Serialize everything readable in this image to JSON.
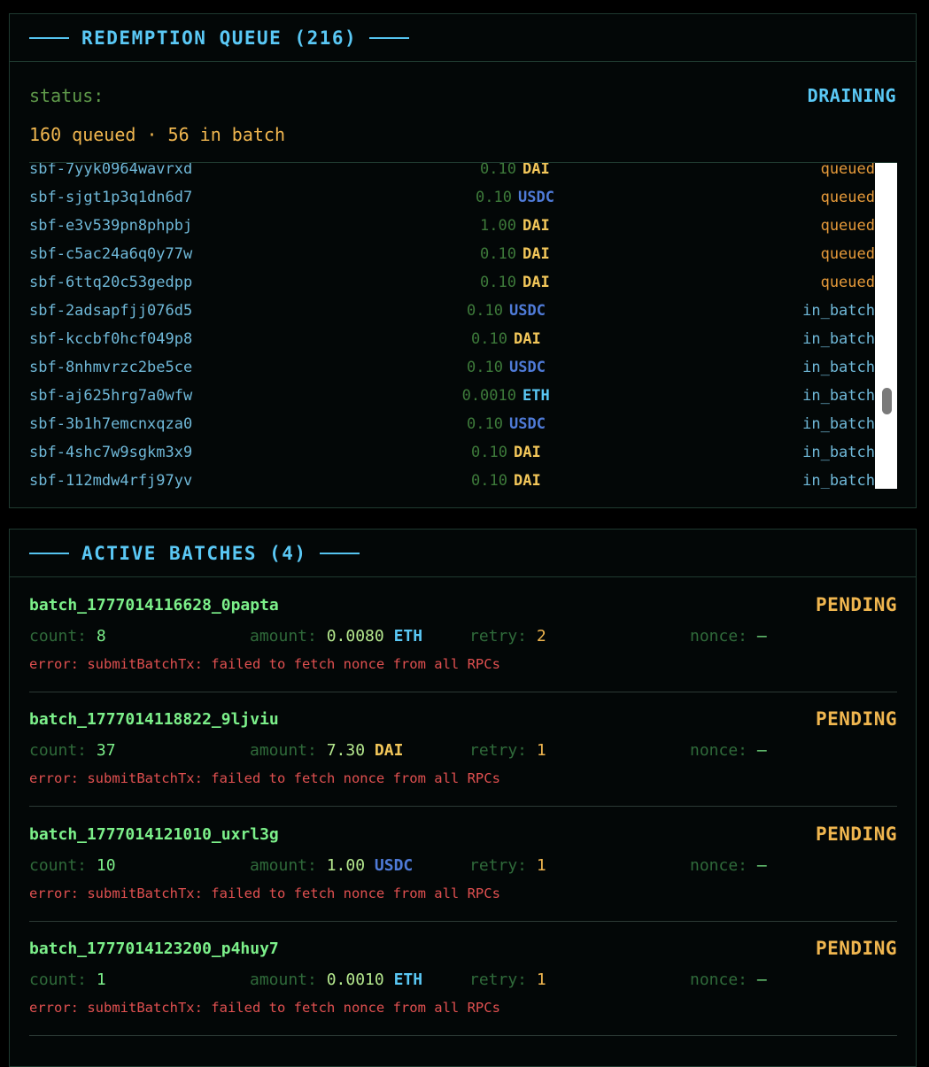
{
  "queue": {
    "title": "REDEMPTION QUEUE (216)",
    "status_label": "status:",
    "status_value": "DRAINING",
    "summary": "160 queued · 56 in batch",
    "rows": [
      {
        "id": "sbf-7yyk0964wavrxd",
        "amount": "0.10",
        "token": "DAI",
        "status": "queued"
      },
      {
        "id": "sbf-sjgt1p3q1dn6d7",
        "amount": "0.10",
        "token": "USDC",
        "status": "queued"
      },
      {
        "id": "sbf-e3v539pn8phpbj",
        "amount": "1.00",
        "token": "DAI",
        "status": "queued"
      },
      {
        "id": "sbf-c5ac24a6q0y77w",
        "amount": "0.10",
        "token": "DAI",
        "status": "queued"
      },
      {
        "id": "sbf-6ttq20c53gedpp",
        "amount": "0.10",
        "token": "DAI",
        "status": "queued"
      },
      {
        "id": "sbf-2adsapfjj076d5",
        "amount": "0.10",
        "token": "USDC",
        "status": "in_batch"
      },
      {
        "id": "sbf-kccbf0hcf049p8",
        "amount": "0.10",
        "token": "DAI",
        "status": "in_batch"
      },
      {
        "id": "sbf-8nhmvrzc2be5ce",
        "amount": "0.10",
        "token": "USDC",
        "status": "in_batch"
      },
      {
        "id": "sbf-aj625hrg7a0wfw",
        "amount": "0.0010",
        "token": "ETH",
        "status": "in_batch"
      },
      {
        "id": "sbf-3b1h7emcnxqza0",
        "amount": "0.10",
        "token": "USDC",
        "status": "in_batch"
      },
      {
        "id": "sbf-4shc7w9sgkm3x9",
        "amount": "0.10",
        "token": "DAI",
        "status": "in_batch"
      },
      {
        "id": "sbf-112mdw4rfj97yv",
        "amount": "0.10",
        "token": "DAI",
        "status": "in_batch"
      }
    ]
  },
  "batches": {
    "title": "ACTIVE BATCHES (4)",
    "labels": {
      "count": "count:",
      "amount": "amount:",
      "retry": "retry:",
      "nonce": "nonce:"
    },
    "items": [
      {
        "id": "batch_1777014116628_0papta",
        "state": "PENDING",
        "count": "8",
        "amount": "0.0080",
        "token": "ETH",
        "retry": "2",
        "nonce": "—",
        "error": "error: submitBatchTx: failed to fetch nonce from all RPCs"
      },
      {
        "id": "batch_1777014118822_9ljviu",
        "state": "PENDING",
        "count": "37",
        "amount": "7.30",
        "token": "DAI",
        "retry": "1",
        "nonce": "—",
        "error": "error: submitBatchTx: failed to fetch nonce from all RPCs"
      },
      {
        "id": "batch_1777014121010_uxrl3g",
        "state": "PENDING",
        "count": "10",
        "amount": "1.00",
        "token": "USDC",
        "retry": "1",
        "nonce": "—",
        "error": "error: submitBatchTx: failed to fetch nonce from all RPCs"
      },
      {
        "id": "batch_1777014123200_p4huy7",
        "state": "PENDING",
        "count": "1",
        "amount": "0.0010",
        "token": "ETH",
        "retry": "1",
        "nonce": "—",
        "error": "error: submitBatchTx: failed to fetch nonce from all RPCs"
      }
    ]
  },
  "colors": {
    "DAI": "#f3c75a",
    "USDC": "#4f7bd8",
    "ETH": "#5ac8f5",
    "queued": "#e69a3a",
    "in_batch": "#6fb8d8",
    "pending": "#f0b64f",
    "error": "#e05050"
  }
}
